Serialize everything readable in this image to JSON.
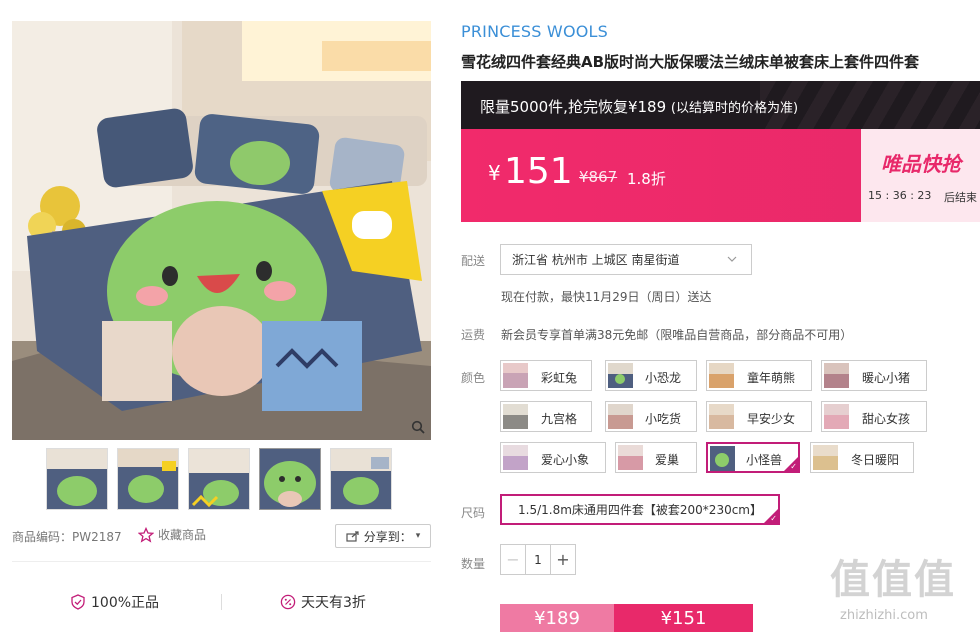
{
  "product": {
    "brand": "PRINCESS WOOLS",
    "title": "雪花绒四件套经典AB版时尚大版保暖法兰绒床单被套床上套件四件套",
    "code_label": "商品编码：PW2187",
    "favorite_label": "收藏商品",
    "share_label": "分享到：",
    "images": {
      "main": "bedding-main-photo",
      "thumbnails": [
        "thumb-1",
        "thumb-2",
        "thumb-3",
        "thumb-4",
        "thumb-5"
      ],
      "active_thumbnail": 4
    }
  },
  "assurance": {
    "genuine": "100%正品",
    "discount": "天天有3折"
  },
  "promo": {
    "limit_text": "限量5000件,抢完恢复¥189",
    "limit_note": "(以结算时的价格为准)",
    "currency": "¥",
    "price": "151",
    "original_price": "¥867",
    "discount": "1.8折",
    "flash_title": "唯品快抢",
    "countdown": "15 : 36 : 23",
    "ends_label": "后结束"
  },
  "delivery": {
    "label": "配送",
    "address": "浙江省 杭州市 上城区 南星街道",
    "eta": "现在付款，最快11月29日（周日）送达"
  },
  "shipping": {
    "label": "运费",
    "text": "新会员专享首单满38元免邮（限唯品自营商品，部分商品不可用）"
  },
  "colors": {
    "label": "颜色",
    "options": [
      "彩虹兔",
      "小恐龙",
      "童年萌熊",
      "暖心小猪",
      "九宫格",
      "小吃货",
      "早安少女",
      "甜心女孩",
      "爱心小象",
      "爱巢",
      "小怪兽",
      "冬日暖阳"
    ],
    "selected": "小怪兽"
  },
  "size": {
    "label": "尺码",
    "selected": "1.5/1.8m床通用四件套【被套200*230cm】"
  },
  "quantity": {
    "label": "数量",
    "value": "1",
    "minus": "−",
    "plus": "+"
  },
  "buy": {
    "original_button": "¥189",
    "now_button": "¥151"
  },
  "watermark": {
    "glyphs": "值值值",
    "url": "zhizhizhi.com"
  },
  "colors_theme": {
    "accent": "#e8296a",
    "select_border": "#c21d78",
    "brand_blue": "#3b8fd7"
  }
}
